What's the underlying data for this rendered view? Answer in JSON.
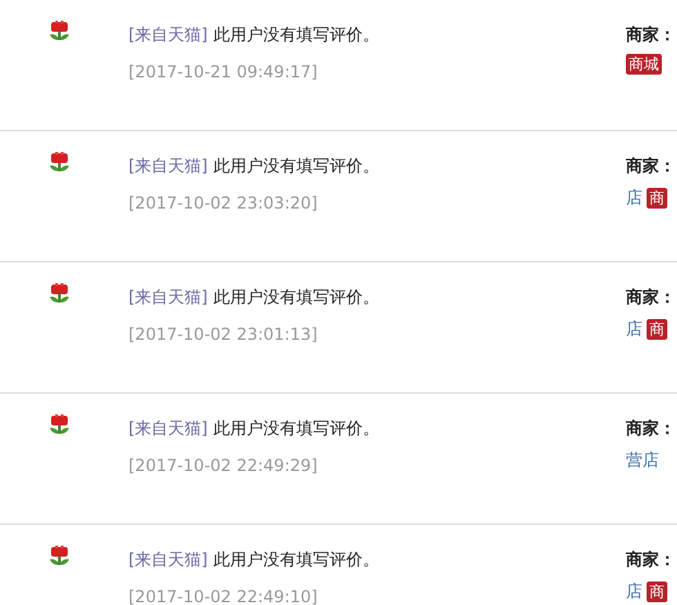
{
  "reviews": [
    {
      "source": "[来自天猫]",
      "comment": "此用户没有填写评价。",
      "time": "[2017-10-21 09:49:17]",
      "seller_label": "商家：",
      "badge": "商城"
    },
    {
      "source": "[来自天猫]",
      "comment": "此用户没有填写评价。",
      "time": "[2017-10-02 23:03:20]",
      "seller_label": "商家：",
      "shop": "店",
      "badge": "商"
    },
    {
      "source": "[来自天猫]",
      "comment": "此用户没有填写评价。",
      "time": "[2017-10-02 23:01:13]",
      "seller_label": "商家：",
      "shop": "店",
      "badge": "商"
    },
    {
      "source": "[来自天猫]",
      "comment": "此用户没有填写评价。",
      "time": "[2017-10-02 22:49:29]",
      "seller_label": "商家：",
      "shop": "营店"
    },
    {
      "source": "[来自天猫]",
      "comment": "此用户没有填写评价。",
      "time": "[2017-10-02 22:49:10]",
      "seller_label": "商家：",
      "shop": "店",
      "badge": "商"
    }
  ]
}
